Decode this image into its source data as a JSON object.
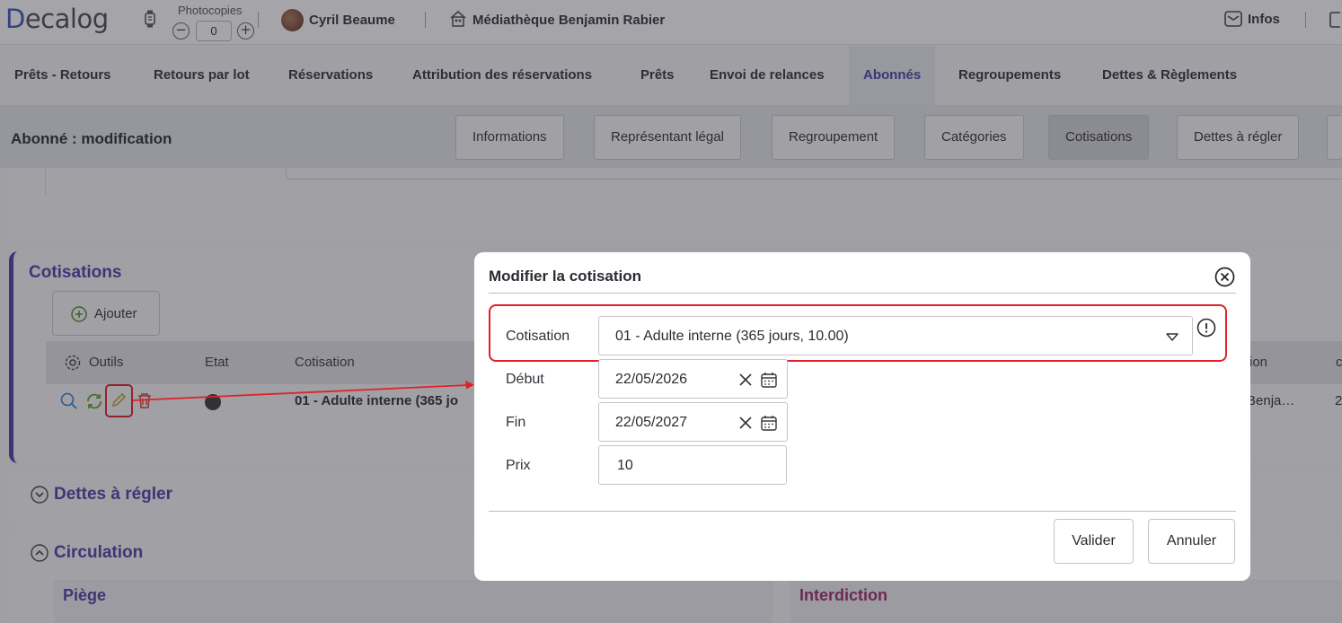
{
  "topbar": {
    "logo": "ecalog",
    "logo_mark": "D",
    "photocopies_label": "Photocopies",
    "photocopies_value": "0",
    "minus": "−",
    "plus": "+",
    "user": "Cyril Beaume",
    "library": "Médiathèque Benjamin Rabier",
    "infos": "Infos"
  },
  "nav": {
    "tabs": [
      "Prêts - Retours",
      "Retours par lot",
      "Réservations",
      "Attribution des réservations",
      "Prêts",
      "Envoi de relances",
      "Abonnés",
      "Regroupements",
      "Dettes & Règlements"
    ],
    "active": "Abonnés"
  },
  "subheader": {
    "title": "Abonné : modification",
    "tabs": [
      "Informations",
      "Représentant légal",
      "Regroupement",
      "Catégories",
      "Cotisations",
      "Dettes à régler"
    ]
  },
  "cotisations_section": {
    "title": "Cotisations",
    "add_button": "Ajouter",
    "columns": [
      "Outils",
      "Etat",
      "Cotisation",
      "ion",
      "c"
    ],
    "row": {
      "cotisation": "01 - Adulte interne (365 jo",
      "right_cell": "Benja…",
      "right_cell2": "2"
    }
  },
  "dettes_section": {
    "title": "Dettes à régler"
  },
  "circulation_section": {
    "title": "Circulation",
    "left_sub": "Piège",
    "right_sub": "Interdiction"
  },
  "modal": {
    "title": "Modifier la cotisation",
    "labels": {
      "cotisation": "Cotisation",
      "debut": "Début",
      "fin": "Fin",
      "prix": "Prix"
    },
    "values": {
      "cotisation": "01 - Adulte interne (365 jours, 10.00)",
      "debut": "22/05/2026",
      "fin": "22/05/2027",
      "prix": "10"
    },
    "buttons": {
      "validate": "Valider",
      "cancel": "Annuler"
    }
  },
  "colors": {
    "accent": "#4e3fa8",
    "annotation_red": "#e0202a"
  }
}
